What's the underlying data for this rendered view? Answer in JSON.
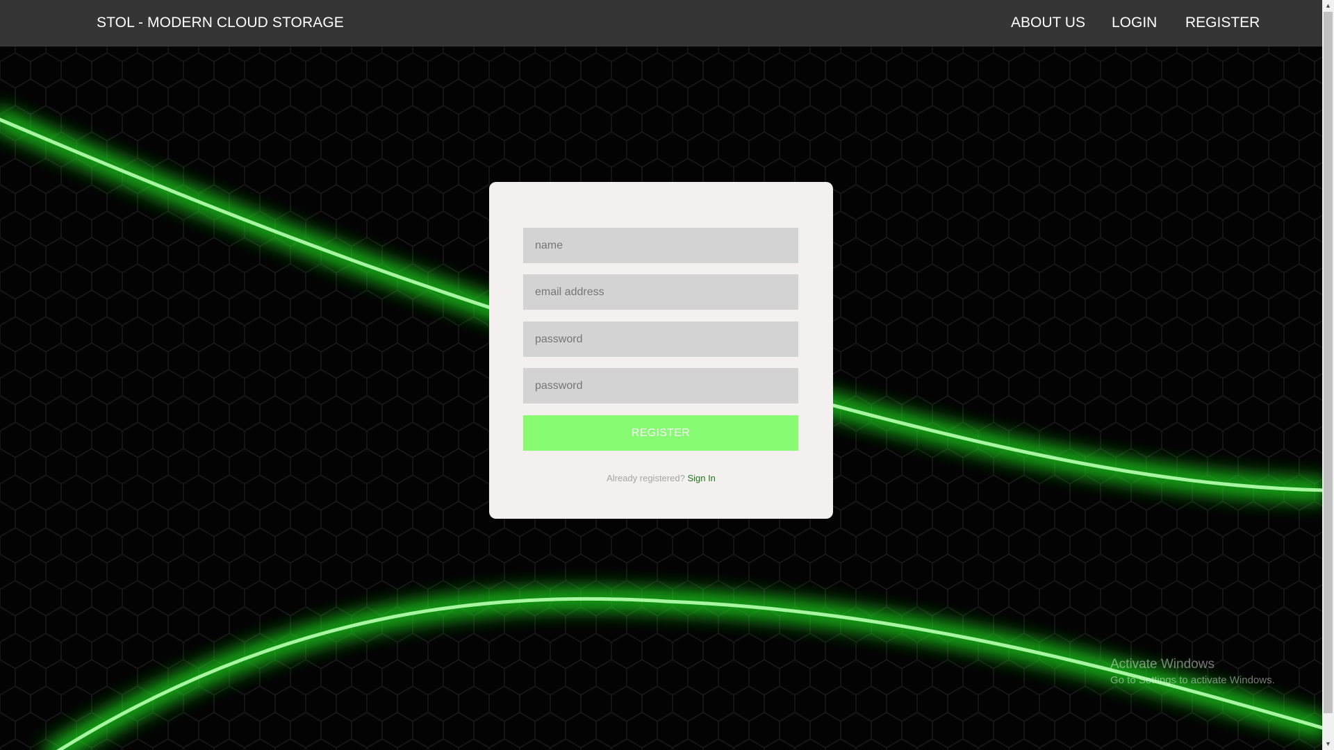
{
  "navbar": {
    "brand": "STOL - MODERN CLOUD STORAGE",
    "links": [
      "ABOUT US",
      "LOGIN",
      "REGISTER"
    ]
  },
  "form": {
    "name_placeholder": "name",
    "email_placeholder": "email address",
    "password_placeholder": "password",
    "confirm_placeholder": "password",
    "register_label": "REGISTER",
    "already_text": "Already registered?",
    "signin_label": "Sign In"
  },
  "watermark": {
    "title": "Activate Windows",
    "subtitle": "Go to Settings to activate Windows."
  },
  "colors": {
    "navbar": "#353535",
    "card": "#f3f0ef",
    "field": "#d3d3d3",
    "button": "#87fb71",
    "link": "#1a7a1a",
    "glow": "#1fdc1f"
  }
}
